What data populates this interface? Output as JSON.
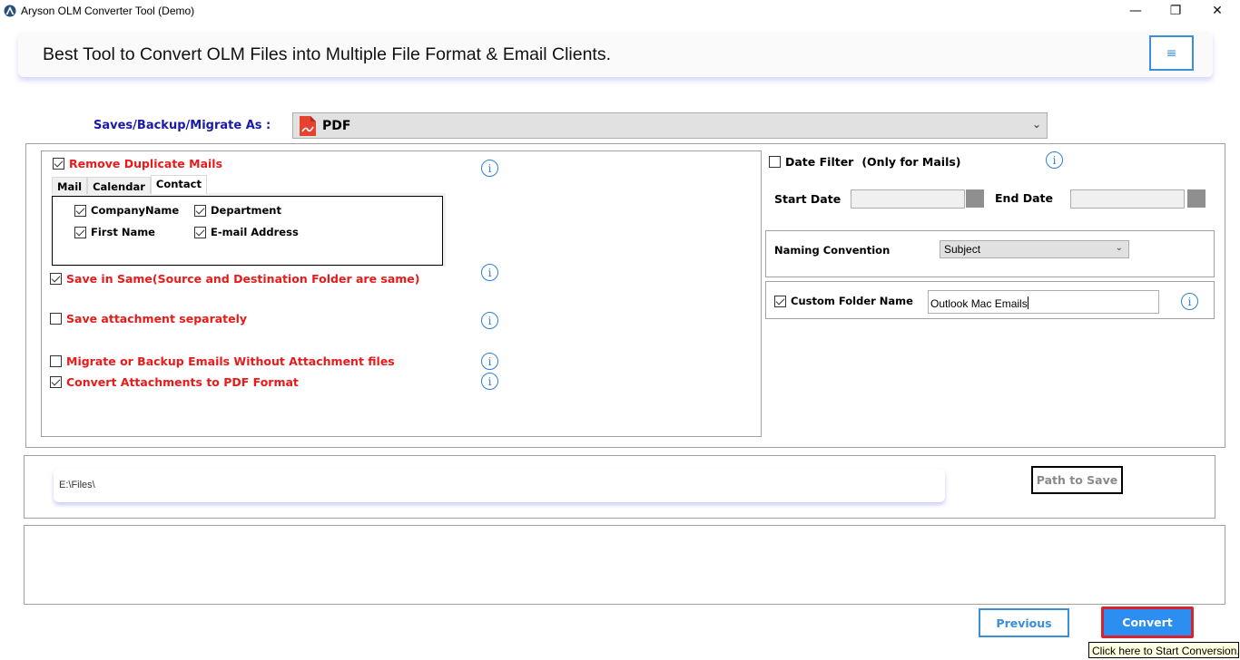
{
  "window": {
    "title": "Aryson OLM Converter Tool (Demo)",
    "controls": {
      "minimize": "—",
      "maximize": "❐",
      "close": "✕"
    }
  },
  "header": {
    "tagline": "Best Tool to Convert OLM Files into Multiple File Format & Email Clients.",
    "menu_icon": "≡"
  },
  "save_as": {
    "label": "Saves/Backup/Migrate As :",
    "selected_format": "PDF",
    "format_icon": "pdf-icon"
  },
  "options": {
    "remove_duplicates": {
      "label": "Remove Duplicate Mails",
      "checked": true
    },
    "tabs": [
      {
        "label": "Mail",
        "active": false
      },
      {
        "label": "Calendar",
        "active": false
      },
      {
        "label": "Contact",
        "active": true
      }
    ],
    "contact_fields": [
      {
        "label": "CompanyName",
        "checked": true
      },
      {
        "label": "Department",
        "checked": true
      },
      {
        "label": "First Name",
        "checked": true
      },
      {
        "label": "E-mail Address",
        "checked": true
      }
    ],
    "save_in_same": {
      "label": "Save in Same(Source and Destination Folder are same)",
      "checked": true
    },
    "save_attachment_separately": {
      "label": "Save attachment separately",
      "checked": false
    },
    "without_attachments": {
      "label": "Migrate or Backup Emails Without Attachment files",
      "checked": false
    },
    "convert_attachments_pdf": {
      "label": "Convert Attachments to PDF Format",
      "checked": true
    },
    "info_glyph": "i"
  },
  "date_filter": {
    "label": "Date Filter",
    "note": "(Only for Mails)",
    "checked": false,
    "start_label": "Start Date",
    "end_label": "End Date",
    "start_value": "",
    "end_value": ""
  },
  "naming": {
    "label": "Naming Convention",
    "selected": "Subject"
  },
  "custom_folder": {
    "label": "Custom Folder Name",
    "checked": true,
    "value": "Outlook Mac Emails"
  },
  "path": {
    "value": "E:\\Files\\",
    "button_label": "Path to Save"
  },
  "footer": {
    "previous_label": "Previous",
    "convert_label": "Convert",
    "tooltip": "Click here to Start Conversion."
  },
  "colors": {
    "accent_blue": "#3a8fdc",
    "option_red": "#e81a1a",
    "convert_bg": "#2b8ef0",
    "convert_border": "#d8232f",
    "label_navy": "#1a1aa8"
  }
}
